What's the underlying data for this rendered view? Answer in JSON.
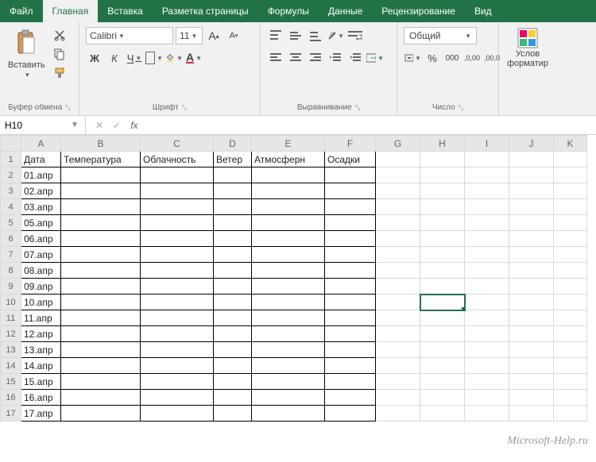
{
  "tabs": [
    "Файл",
    "Главная",
    "Вставка",
    "Разметка страницы",
    "Формулы",
    "Данные",
    "Рецензирование",
    "Вид"
  ],
  "active_tab": 1,
  "ribbon": {
    "clipboard": {
      "paste_label": "Вставить",
      "group_label": "Буфер обмена"
    },
    "font": {
      "name": "Calibri",
      "size": "11",
      "group_label": "Шрифт"
    },
    "alignment": {
      "group_label": "Выравнивание"
    },
    "number": {
      "format": "Общий",
      "group_label": "Число"
    },
    "styles": {
      "conditional_line1": "Услов",
      "conditional_line2": "форматир"
    }
  },
  "namebox": "H10",
  "formula": "",
  "columns": [
    {
      "letter": "A",
      "width": 50
    },
    {
      "letter": "B",
      "width": 100
    },
    {
      "letter": "C",
      "width": 92
    },
    {
      "letter": "D",
      "width": 48
    },
    {
      "letter": "E",
      "width": 92
    },
    {
      "letter": "F",
      "width": 64
    },
    {
      "letter": "G",
      "width": 56
    },
    {
      "letter": "H",
      "width": 56
    },
    {
      "letter": "I",
      "width": 56
    },
    {
      "letter": "J",
      "width": 56
    },
    {
      "letter": "K",
      "width": 42
    }
  ],
  "headers": [
    "Дата",
    "Температура",
    "Облачность",
    "Ветер",
    "Атмосферн",
    "Осадки"
  ],
  "dates": [
    "01.апр",
    "02.апр",
    "03.апр",
    "05.апр",
    "06.апр",
    "07.апр",
    "08.апр",
    "09.апр",
    "10.апр",
    "11.апр",
    "12.апр",
    "13.апр",
    "14.апр",
    "15.апр",
    "16.апр",
    "17.апр"
  ],
  "active_cell": {
    "row": 10,
    "col": "H"
  },
  "watermark": "Microsoft-Help.ru"
}
